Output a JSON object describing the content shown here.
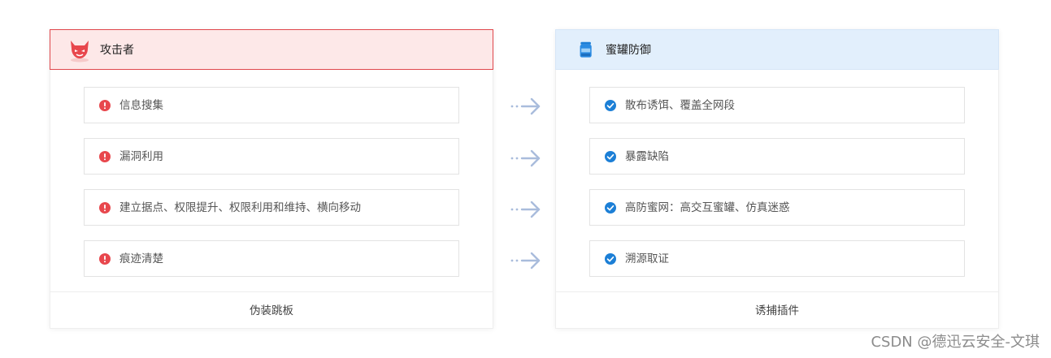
{
  "attacker": {
    "title": "攻击者",
    "items": [
      "信息搜集",
      "漏洞利用",
      "建立据点、权限提升、权限利用和维持、横向移动",
      "痕迹清楚"
    ],
    "footer": "伪装跳板",
    "icon": "devil-mask-icon",
    "accent": "#e0474c"
  },
  "defense": {
    "title": "蜜罐防御",
    "items": [
      "散布诱饵、覆盖全网段",
      "暴露缺陷",
      "高防蜜网：高交互蜜罐、仿真迷惑",
      "溯源取证"
    ],
    "footer": "诱捕插件",
    "icon": "honeypot-jar-icon",
    "accent": "#1c7fd6"
  },
  "arrows": [
    "arrow-right-icon",
    "arrow-right-icon",
    "arrow-right-icon",
    "arrow-right-icon"
  ],
  "watermark": "CSDN @德迅云安全-文琪"
}
